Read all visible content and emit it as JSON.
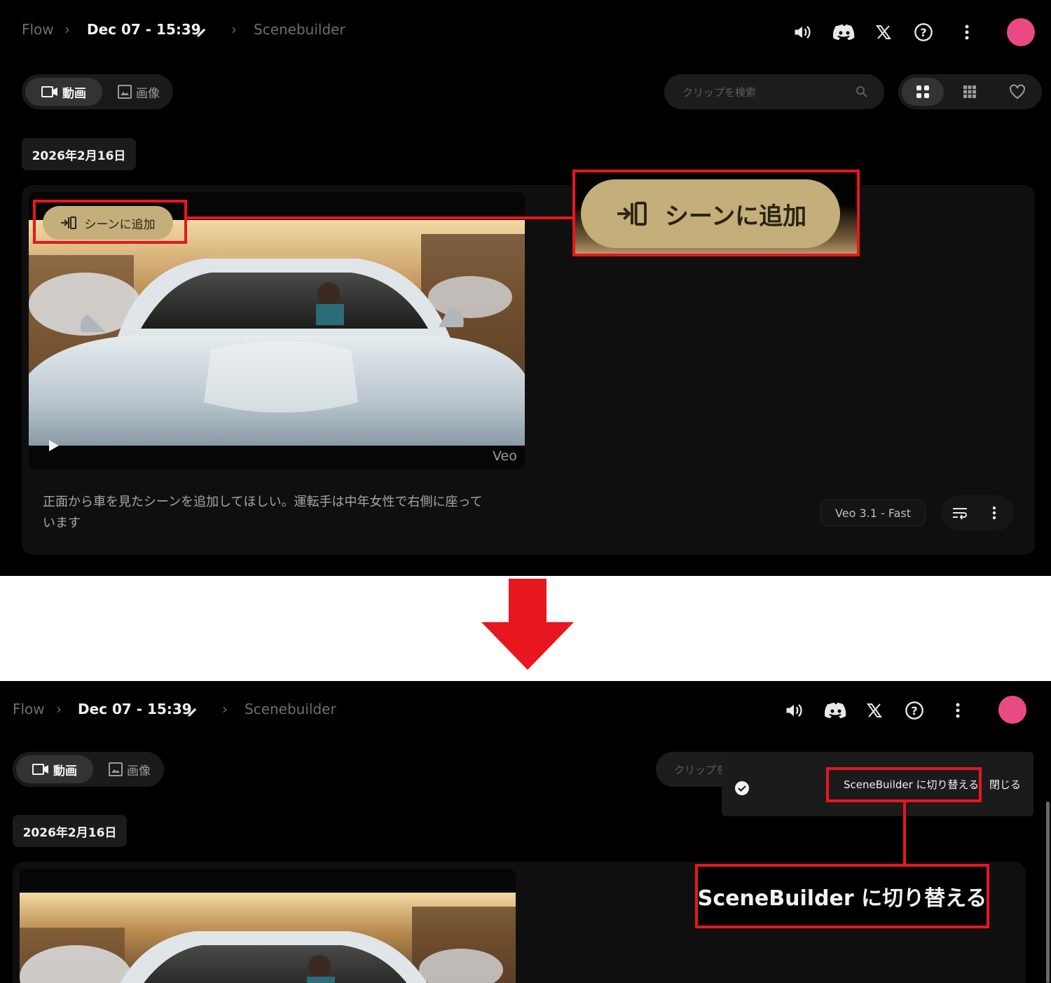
{
  "breadcrumb": {
    "root": "Flow",
    "project": "Dec 07 - 15:39",
    "page": "Scenebuilder"
  },
  "tabs": {
    "video": "動画",
    "image": "画像"
  },
  "search": {
    "placeholder": "クリップを検索",
    "placeholder_truncated": "クリップを"
  },
  "date_chip": "2026年2月16日",
  "clip": {
    "add_to_scene": "シーンに追加",
    "watermark": "Veo",
    "prompt_line1": "正面から車を見たシーンを追加してほしい。運転手は中年女性で右側に座って",
    "prompt_line2": "います",
    "model": "Veo 3.1 - Fast"
  },
  "toast": {
    "switch_label": "SceneBuilder に切り替える",
    "close_label": "閉じる"
  },
  "callouts": {
    "add_to_scene_zoom": "シーンに追加",
    "switch_zoom": "SceneBuilder に切り替える"
  },
  "colors": {
    "accent_red": "#e8161f",
    "avatar": "#ea4a83",
    "pill_gold": "#c4ae79"
  },
  "icons": [
    "volume-icon",
    "discord-icon",
    "x-icon",
    "help-icon",
    "more-vert-icon",
    "pencil-icon",
    "video-icon",
    "image-icon",
    "search-icon",
    "grid-large-icon",
    "grid-small-icon",
    "heart-icon",
    "add-to-scene-icon",
    "play-icon",
    "extend-icon",
    "check-icon"
  ]
}
